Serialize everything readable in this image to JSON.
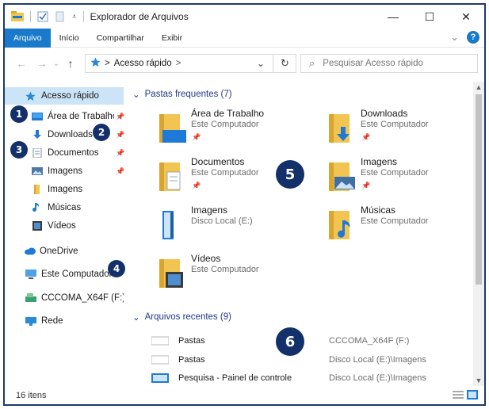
{
  "window": {
    "title": "Explorador de Arquivos",
    "controls": {
      "minimize": "—",
      "maximize": "☐",
      "close": "✕"
    }
  },
  "ribbon": {
    "tabs": [
      "Arquivo",
      "Início",
      "Compartilhar",
      "Exibir"
    ],
    "active_tab": "Arquivo",
    "expand": "⌄",
    "help": "?"
  },
  "nav": {
    "back": "←",
    "forward": "→",
    "recent": "⌄",
    "up": "↑",
    "address_separator": ">",
    "address": "Acesso rápido",
    "address_chevron": ">",
    "address_dropdown": "⌄",
    "refresh": "↻",
    "search_icon": "⌕",
    "search_placeholder": "Pesquisar Acesso rápido"
  },
  "sidebar": {
    "quick_access": "Acesso rápido",
    "items": [
      {
        "label": "Área de Trabalho",
        "icon": "desktop-icon",
        "pinned": true
      },
      {
        "label": "Downloads",
        "icon": "downloads-icon",
        "pinned": true
      },
      {
        "label": "Documentos",
        "icon": "documents-icon",
        "pinned": true
      },
      {
        "label": "Imagens",
        "icon": "pictures-icon",
        "pinned": true
      },
      {
        "label": "Imagens",
        "icon": "folder-icon",
        "pinned": false
      },
      {
        "label": "Músicas",
        "icon": "music-icon",
        "pinned": false
      },
      {
        "label": "Vídeos",
        "icon": "videos-icon",
        "pinned": false
      }
    ],
    "onedrive": "OneDrive",
    "this_pc": "Este Computador",
    "drive": "CCCOMA_X64F (F:)",
    "network": "Rede",
    "pin_glyph": "📌"
  },
  "frequent": {
    "header": "Pastas frequentes (7)",
    "chevron": "⌄",
    "tiles": [
      {
        "name": "Área de Trabalho",
        "location": "Este Computador",
        "pinned": true,
        "icon": "desktop-folder-icon"
      },
      {
        "name": "Downloads",
        "location": "Este Computador",
        "pinned": true,
        "icon": "downloads-folder-icon"
      },
      {
        "name": "Documentos",
        "location": "Este Computador",
        "pinned": true,
        "icon": "documents-folder-icon"
      },
      {
        "name": "Imagens",
        "location": "Este Computador",
        "pinned": true,
        "icon": "pictures-folder-icon"
      },
      {
        "name": "Imagens",
        "location": "Disco Local (E:)",
        "pinned": false,
        "icon": "pictures-folder-icon"
      },
      {
        "name": "Músicas",
        "location": "Este Computador",
        "pinned": false,
        "icon": "music-folder-icon"
      },
      {
        "name": "Vídeos",
        "location": "Este Computador",
        "pinned": false,
        "icon": "videos-folder-icon"
      }
    ]
  },
  "recent": {
    "header": "Arquivos recentes (9)",
    "chevron": "⌄",
    "rows": [
      {
        "name": "Pastas",
        "location": "CCCOMA_X64F (F:)"
      },
      {
        "name": "Pastas",
        "location": "Disco Local (E:)\\Imagens"
      },
      {
        "name": "Pesquisa - Painel de controle",
        "location": "Disco Local (E:)\\Imagens"
      }
    ]
  },
  "status": {
    "count": "16 itens"
  },
  "badges": [
    "1",
    "2",
    "3",
    "4",
    "5",
    "6"
  ],
  "colors": {
    "accent": "#1979ca",
    "badge": "#14306b",
    "folder": "#f2c553",
    "selected": "#cce4f7"
  }
}
